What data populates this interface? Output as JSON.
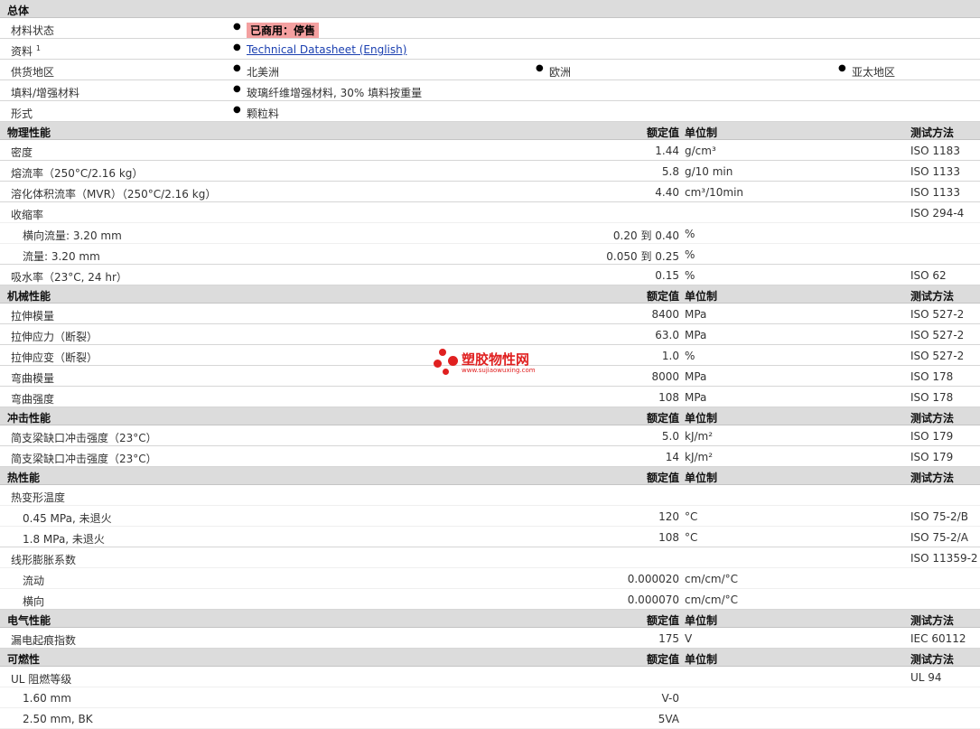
{
  "general": {
    "title": "总体",
    "status_label": "材料状态",
    "status_value": "已商用：停售",
    "docs_label": "资料",
    "docs_sup": "1",
    "docs_link": "Technical Datasheet (English)",
    "region_label": "供货地区",
    "regions": [
      "北美洲",
      "欧洲",
      "亚太地区"
    ],
    "filler_label": "填料/增强材料",
    "filler_value": "玻璃纤维增强材料, 30% 填料按重量",
    "form_label": "形式",
    "form_value": "颗粒料"
  },
  "headers": {
    "value": "额定值",
    "unit": "单位制",
    "method": "测试方法"
  },
  "physical": {
    "title": "物理性能",
    "density": {
      "label": "密度",
      "value": "1.44",
      "unit": "g/cm³",
      "method": "ISO 1183"
    },
    "mfr": {
      "label": "熔流率（250°C/2.16 kg）",
      "value": "5.8",
      "unit": "g/10 min",
      "method": "ISO 1133"
    },
    "mvr": {
      "label": "溶化体积流率（MVR）（250°C/2.16 kg）",
      "value": "4.40",
      "unit": "cm³/10min",
      "method": "ISO 1133"
    },
    "shrink": {
      "label": "收缩率",
      "method": "ISO 294-4"
    },
    "shrink_td": {
      "label": "横向流量: 3.20 mm",
      "value": "0.20 到 0.40",
      "unit": "%"
    },
    "shrink_md": {
      "label": "流量: 3.20 mm",
      "value": "0.050 到 0.25",
      "unit": "%"
    },
    "water": {
      "label": "吸水率（23°C, 24 hr）",
      "value": "0.15",
      "unit": "%",
      "method": "ISO 62"
    }
  },
  "mechanical": {
    "title": "机械性能",
    "tmod": {
      "label": "拉伸模量",
      "value": "8400",
      "unit": "MPa",
      "method": "ISO 527-2"
    },
    "tstress": {
      "label": "拉伸应力（断裂）",
      "value": "63.0",
      "unit": "MPa",
      "method": "ISO 527-2"
    },
    "tstrain": {
      "label": "拉伸应变（断裂）",
      "value": "1.0",
      "unit": "%",
      "method": "ISO 527-2"
    },
    "fmod": {
      "label": "弯曲模量",
      "value": "8000",
      "unit": "MPa",
      "method": "ISO 178"
    },
    "fstr": {
      "label": "弯曲强度",
      "value": "108",
      "unit": "MPa",
      "method": "ISO 178"
    }
  },
  "impact": {
    "title": "冲击性能",
    "charpy1": {
      "label": "简支梁缺口冲击强度（23°C）",
      "value": "5.0",
      "unit": "kJ/m²",
      "method": "ISO 179"
    },
    "charpy2": {
      "label": "简支梁缺口冲击强度（23°C）",
      "value": "14",
      "unit": "kJ/m²",
      "method": "ISO 179"
    }
  },
  "thermal": {
    "title": "热性能",
    "hdt": {
      "label": "热变形温度"
    },
    "hdt1": {
      "label": "0.45 MPa, 未退火",
      "value": "120",
      "unit": "°C",
      "method": "ISO 75-2/B"
    },
    "hdt2": {
      "label": "1.8 MPa, 未退火",
      "value": "108",
      "unit": "°C",
      "method": "ISO 75-2/A"
    },
    "clte": {
      "label": "线形膨胀系数",
      "method": "ISO 11359-2"
    },
    "clte1": {
      "label": "流动",
      "value": "0.000020",
      "unit": "cm/cm/°C"
    },
    "clte2": {
      "label": "横向",
      "value": "0.000070",
      "unit": "cm/cm/°C"
    }
  },
  "electrical": {
    "title": "电气性能",
    "cti": {
      "label": "漏电起痕指数",
      "value": "175",
      "unit": "V",
      "method": "IEC 60112"
    }
  },
  "flammability": {
    "title": "可燃性",
    "ul": {
      "label": "UL 阻燃等级",
      "method": "UL 94"
    },
    "ul1": {
      "label": "1.60 mm",
      "value": "V-0"
    },
    "ul2": {
      "label": "2.50 mm, BK",
      "value": "5VA"
    }
  },
  "watermark": {
    "text": "塑胶物性网",
    "url": "www.sujiaowuxing.com",
    "color": "#e02020"
  }
}
